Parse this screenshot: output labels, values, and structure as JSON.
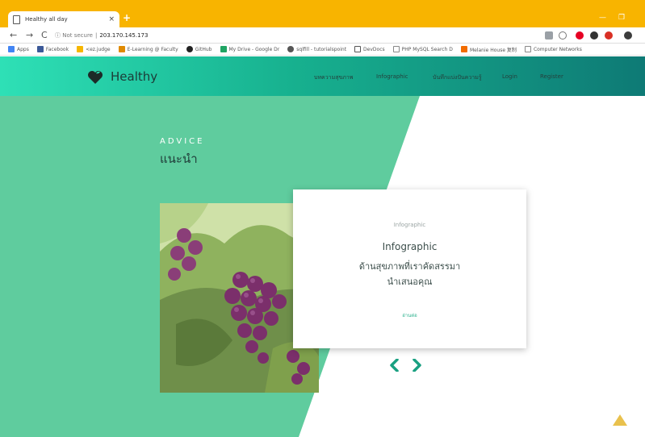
{
  "browser": {
    "tab_title": "Healthy all day",
    "tab_close": "×",
    "new_tab": "+",
    "minimize": "—",
    "restore": "❐",
    "url_security": "ⓘ Not secure",
    "url_separator": "|",
    "url": "203.170.145.173",
    "back": "←",
    "forward": "→",
    "reload": "C"
  },
  "bookmarks": [
    {
      "label": "Apps",
      "color": "#4285f4"
    },
    {
      "label": "Facebook",
      "color": "#3b5998"
    },
    {
      "label": "<ez.judge",
      "color": "#f6b600"
    },
    {
      "label": "E-Learning @ Faculty",
      "color": "#e08a00"
    },
    {
      "label": "GitHub",
      "color": "#222222"
    },
    {
      "label": "My Drive - Google Dr",
      "color": "#1fa463"
    },
    {
      "label": "sqlfill - tutorialspoint",
      "color": "#555555"
    },
    {
      "label": "DevDocs",
      "color": "#555555"
    },
    {
      "label": "PHP MySQL Search D",
      "color": "#888888"
    },
    {
      "label": "Melanie House 复制",
      "color": "#f26c00"
    },
    {
      "label": "Computer Networks",
      "color": "#888888"
    }
  ],
  "header": {
    "logo_text": "Healthy",
    "nav": [
      "บทความสุขภาพ",
      "Infographic",
      "บันทึกแบ่งปันความรู้",
      "Login",
      "Register"
    ]
  },
  "hero": {
    "label": "ADVICE",
    "title": "แนะนำ"
  },
  "card": {
    "small": "Infographic",
    "title": "Infographic",
    "line1": "ด้านสุขภาพที่เราคัดสรรมา",
    "line2": "นำเสนอคุณ",
    "link": "อ่านต่อ"
  },
  "colors": {
    "chrome": "#f8b400",
    "header_start": "#2ee0b6",
    "header_end": "#0e7a75",
    "hero_green": "#5fcc9e",
    "accent": "#1aa081",
    "top_button": "#e9c14d"
  }
}
